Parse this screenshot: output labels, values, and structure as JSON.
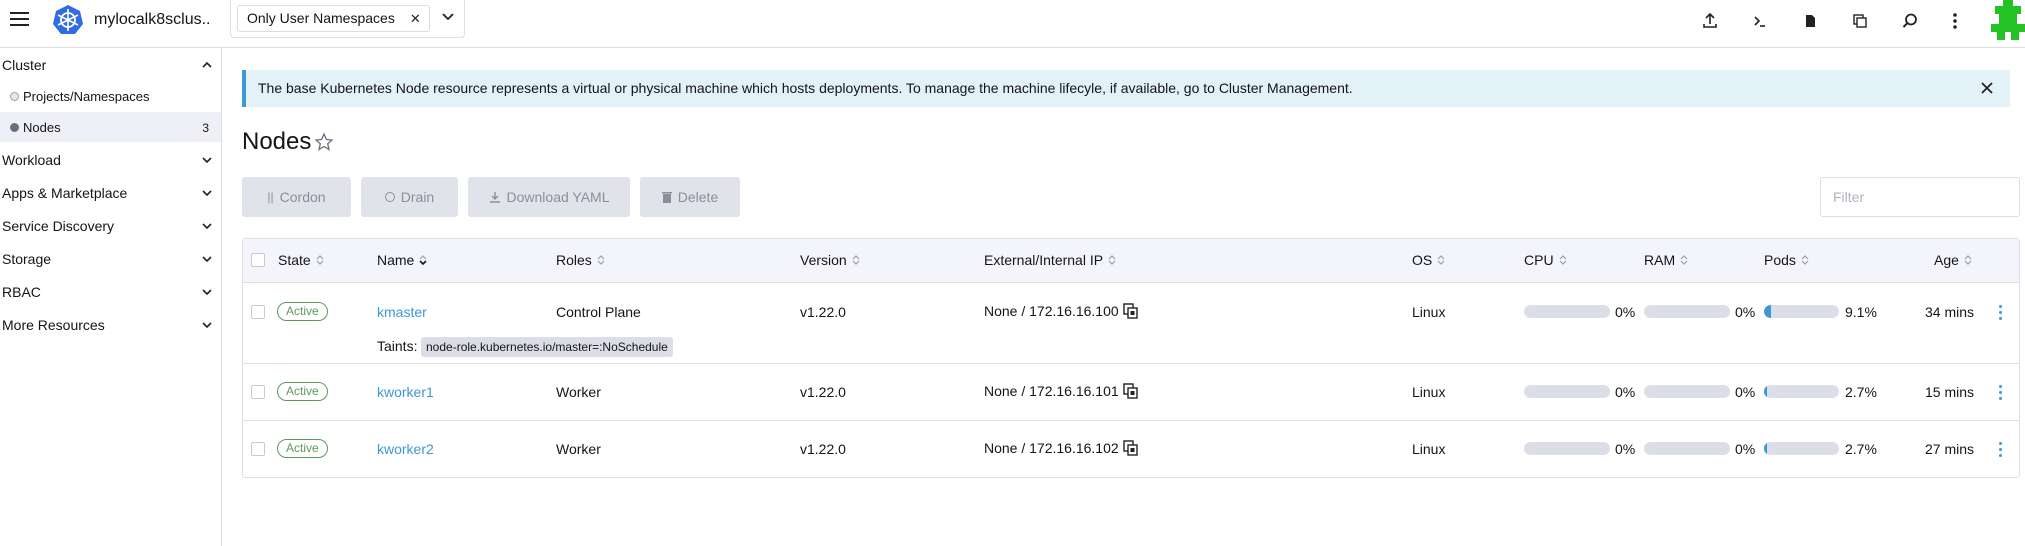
{
  "header": {
    "cluster_name": "mylocalk8sclus...",
    "namespace_filter": "Only User Namespaces"
  },
  "sidebar": {
    "groups": [
      {
        "label": "Cluster",
        "expanded": true
      },
      {
        "label": "Workload"
      },
      {
        "label": "Apps & Marketplace"
      },
      {
        "label": "Service Discovery"
      },
      {
        "label": "Storage"
      },
      {
        "label": "RBAC"
      },
      {
        "label": "More Resources"
      }
    ],
    "cluster_items": [
      {
        "label": "Projects/Namespaces",
        "count": ""
      },
      {
        "label": "Nodes",
        "count": "3",
        "active": true
      }
    ]
  },
  "banner": {
    "text": "The base Kubernetes Node resource represents a virtual or physical machine which hosts deployments. To manage the machine lifecyle, if available, go to Cluster Management."
  },
  "page": {
    "title": "Nodes"
  },
  "actions": {
    "cordon": "Cordon",
    "drain": "Drain",
    "download_yaml": "Download YAML",
    "delete": "Delete",
    "filter_placeholder": "Filter"
  },
  "table": {
    "columns": [
      "State",
      "Name",
      "Roles",
      "Version",
      "External/Internal IP",
      "OS",
      "CPU",
      "RAM",
      "Pods",
      "Age"
    ],
    "taints_label": "Taints:",
    "rows": [
      {
        "state": "Active",
        "name": "kmaster",
        "roles": "Control Plane",
        "version": "v1.22.0",
        "ip": "None / 172.16.16.100",
        "os": "Linux",
        "cpu": "0%",
        "cpu_fraction": 0,
        "ram": "0%",
        "ram_fraction": 0,
        "pods": "9.1%",
        "pods_fraction": 0.091,
        "age": "34 mins",
        "taint": "node-role.kubernetes.io/master=:NoSchedule"
      },
      {
        "state": "Active",
        "name": "kworker1",
        "roles": "Worker",
        "version": "v1.22.0",
        "ip": "None / 172.16.16.101",
        "os": "Linux",
        "cpu": "0%",
        "cpu_fraction": 0,
        "ram": "0%",
        "ram_fraction": 0,
        "pods": "2.7%",
        "pods_fraction": 0.027,
        "age": "15 mins"
      },
      {
        "state": "Active",
        "name": "kworker2",
        "roles": "Worker",
        "version": "v1.22.0",
        "ip": "None / 172.16.16.102",
        "os": "Linux",
        "cpu": "0%",
        "cpu_fraction": 0,
        "ram": "0%",
        "ram_fraction": 0,
        "pods": "2.7%",
        "pods_fraction": 0.027,
        "age": "27 mins"
      }
    ]
  },
  "colors": {
    "accent": "#3d98d3",
    "active_badge": "#5d995d",
    "banner_bg": "#e3f1f9",
    "avatar": "#22c322"
  }
}
